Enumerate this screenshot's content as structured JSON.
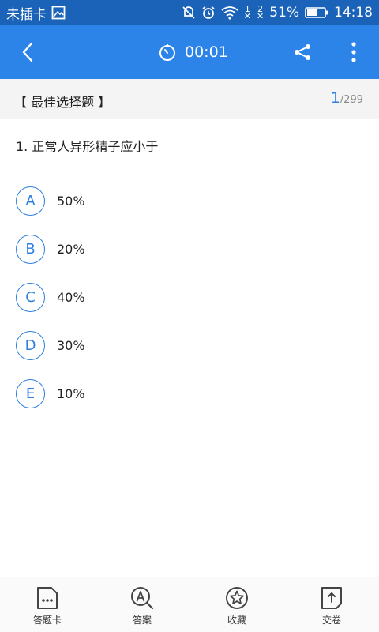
{
  "status_bar": {
    "carrier": "未插卡",
    "sim1_label": "1",
    "sim2_label": "2",
    "battery": "51%",
    "time": "14:18"
  },
  "app_bar": {
    "timer": "00:01"
  },
  "section": {
    "title": "【 最佳选择题 】",
    "current": "1",
    "total": "/299"
  },
  "question": {
    "text": "1. 正常人异形精子应小于",
    "options": [
      {
        "letter": "A",
        "text": "50%"
      },
      {
        "letter": "B",
        "text": "20%"
      },
      {
        "letter": "C",
        "text": "40%"
      },
      {
        "letter": "D",
        "text": "30%"
      },
      {
        "letter": "E",
        "text": "10%"
      }
    ]
  },
  "bottom_nav": [
    {
      "label": "答题卡",
      "icon": "answer-card-icon"
    },
    {
      "label": "答案",
      "icon": "answer-search-icon"
    },
    {
      "label": "收藏",
      "icon": "star-icon"
    },
    {
      "label": "交卷",
      "icon": "submit-icon"
    }
  ],
  "colors": {
    "status_bar": "#1a63b8",
    "app_bar": "#2d84e8",
    "accent": "#2d7fe0"
  }
}
